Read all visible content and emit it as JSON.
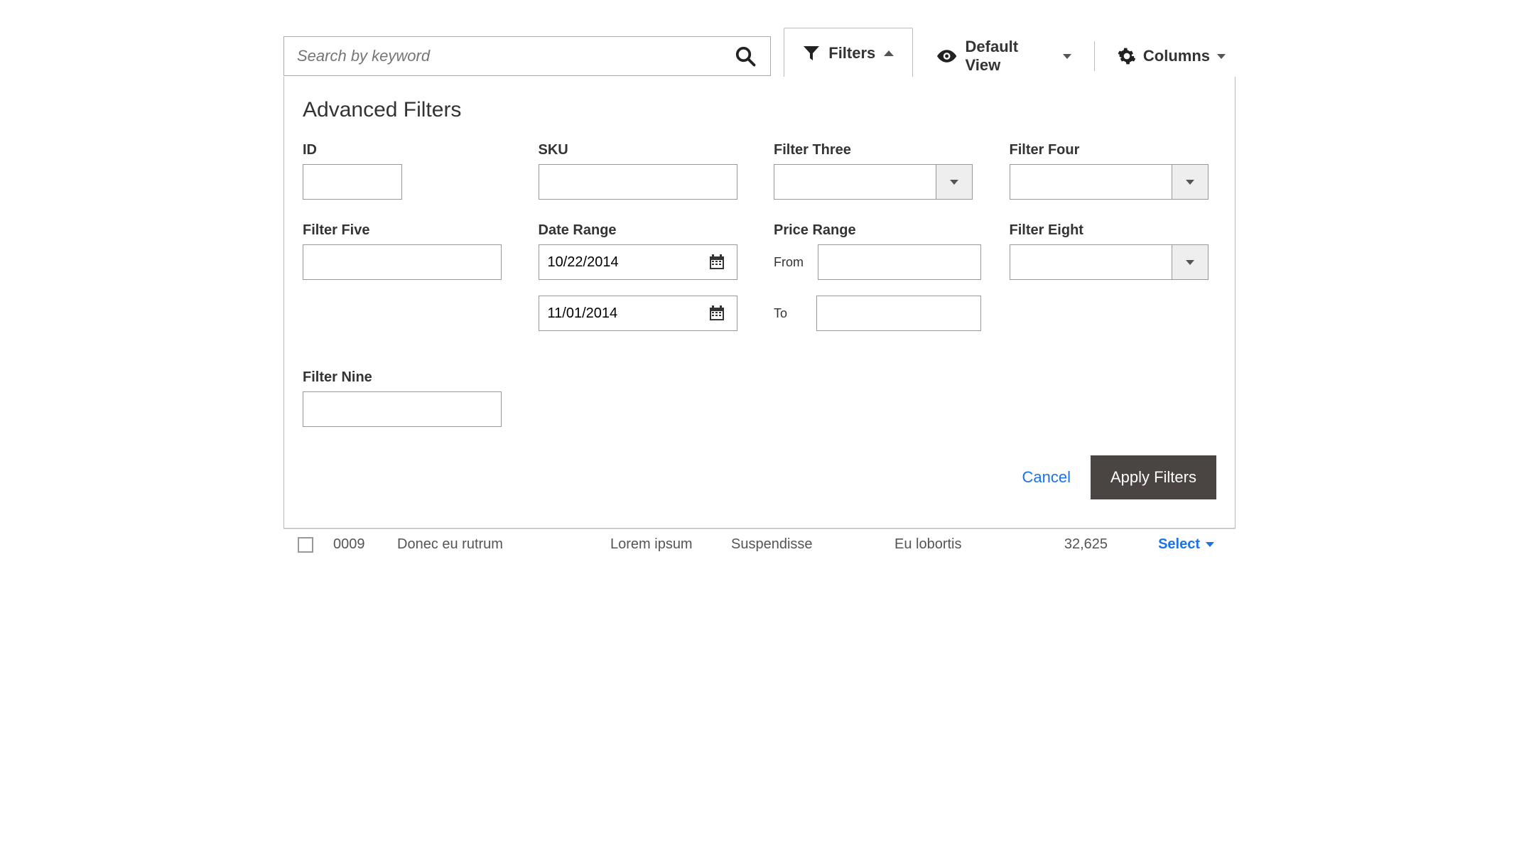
{
  "toolbar": {
    "search_placeholder": "Search by keyword",
    "filters_label": "Filters",
    "default_view_label": "Default View",
    "columns_label": "Columns"
  },
  "panel": {
    "title": "Advanced Filters",
    "fields": {
      "id_label": "ID",
      "sku_label": "SKU",
      "filter_three_label": "Filter Three",
      "filter_four_label": "Filter Four",
      "filter_five_label": "Filter Five",
      "date_range_label": "Date Range",
      "date_from_value": "10/22/2014",
      "date_to_value": "11/01/2014",
      "price_range_label": "Price Range",
      "price_from_label": "From",
      "price_to_label": "To",
      "filter_eight_label": "Filter Eight",
      "filter_nine_label": "Filter Nine"
    },
    "cancel_label": "Cancel",
    "apply_label": "Apply Filters"
  },
  "table": {
    "row": {
      "id": "0009",
      "name": "Donec eu rutrum",
      "col3": "Lorem ipsum",
      "col4": "Suspendisse",
      "col5": "Eu lobortis",
      "num": "32,625",
      "action": "Select"
    }
  }
}
